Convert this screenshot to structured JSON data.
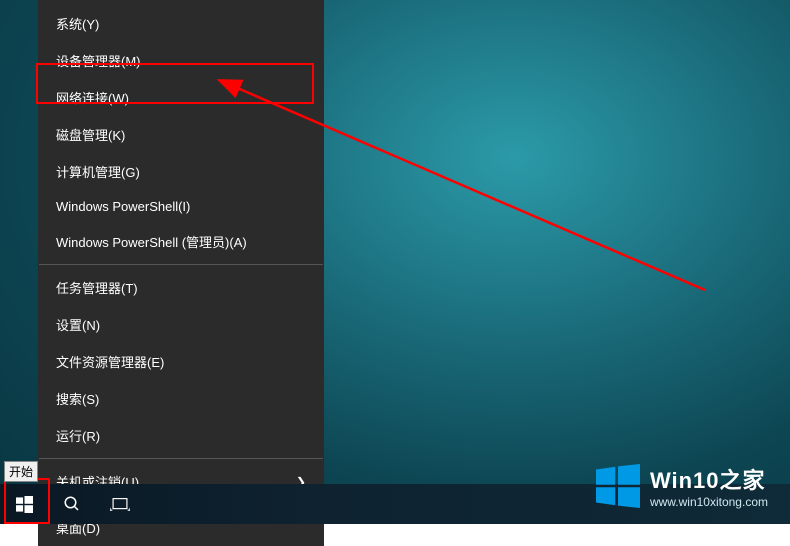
{
  "menu": {
    "system": "系统(Y)",
    "device_manager": "设备管理器(M)",
    "network_connections": "网络连接(W)",
    "disk_management": "磁盘管理(K)",
    "computer_management": "计算机管理(G)",
    "powershell": "Windows PowerShell(I)",
    "powershell_admin": "Windows PowerShell (管理员)(A)",
    "task_manager": "任务管理器(T)",
    "settings": "设置(N)",
    "file_explorer": "文件资源管理器(E)",
    "search": "搜索(S)",
    "run": "运行(R)",
    "shutdown_signout": "关机或注销(U)",
    "desktop": "桌面(D)"
  },
  "tooltip": {
    "start": "开始"
  },
  "watermark": {
    "title": "Win10之家",
    "url": "www.win10xitong.com"
  }
}
